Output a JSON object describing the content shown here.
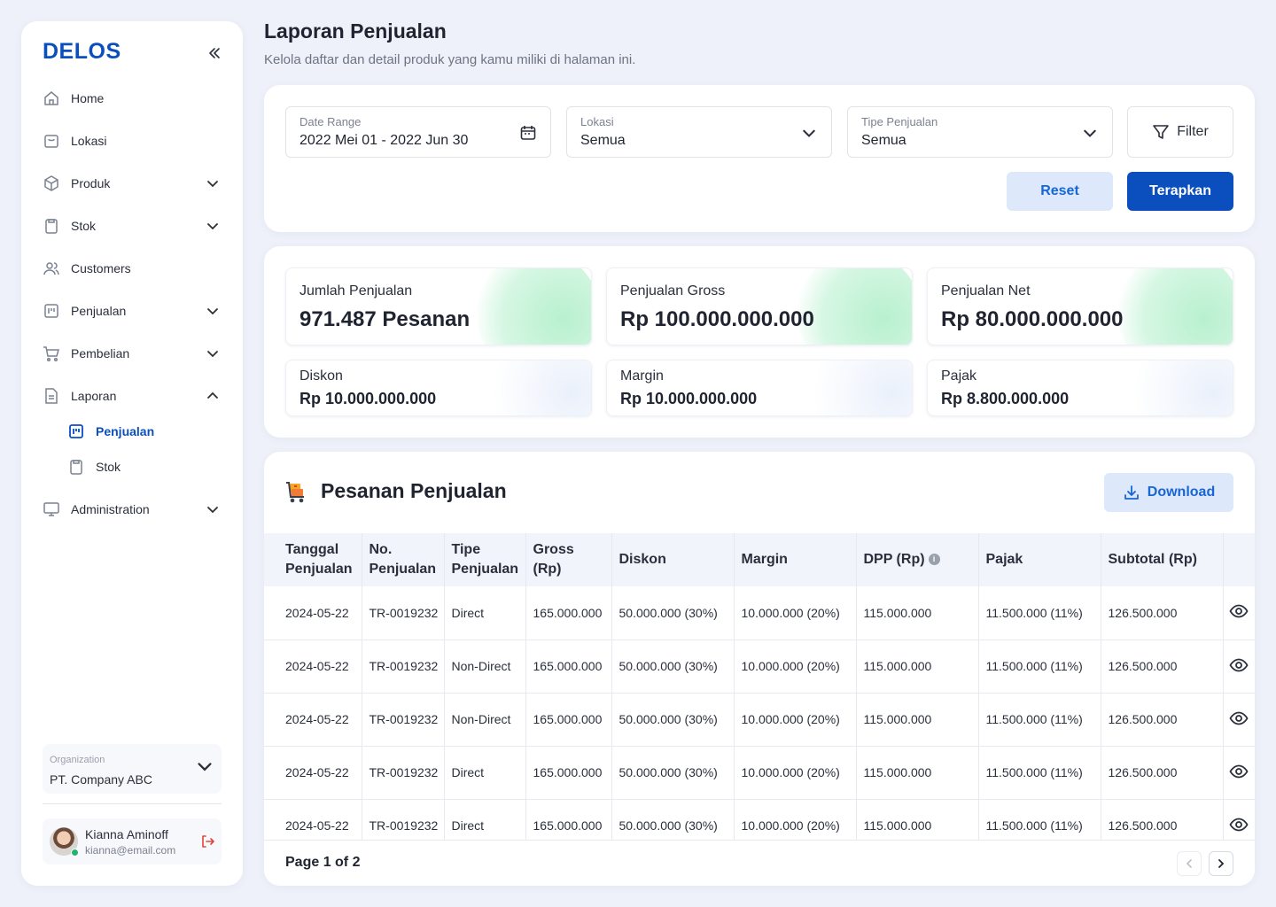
{
  "brand": "DELOS",
  "sidebar": {
    "items": [
      {
        "label": "Home",
        "icon": "home-icon",
        "has_chevron": false
      },
      {
        "label": "Lokasi",
        "icon": "store-icon",
        "has_chevron": false
      },
      {
        "label": "Produk",
        "icon": "box-icon",
        "has_chevron": true
      },
      {
        "label": "Stok",
        "icon": "clipboard-icon",
        "has_chevron": true
      },
      {
        "label": "Customers",
        "icon": "users-icon",
        "has_chevron": false
      },
      {
        "label": "Penjualan",
        "icon": "board-icon",
        "has_chevron": true
      },
      {
        "label": "Pembelian",
        "icon": "cart-icon",
        "has_chevron": true
      },
      {
        "label": "Laporan",
        "icon": "document-icon",
        "has_chevron": true,
        "expanded": true
      },
      {
        "label": "Penjualan",
        "icon": "board-icon",
        "sub": true,
        "active": true
      },
      {
        "label": "Stok",
        "icon": "clipboard-icon",
        "sub": true
      },
      {
        "label": "Administration",
        "icon": "monitor-icon",
        "has_chevron": true
      }
    ],
    "organization": {
      "label": "Organization",
      "value": "PT. Company ABC"
    },
    "user": {
      "name": "Kianna Aminoff",
      "email": "kianna@email.com"
    }
  },
  "header": {
    "title": "Laporan Penjualan",
    "subtitle": "Kelola daftar dan detail produk yang kamu miliki di halaman ini."
  },
  "filters": {
    "date_range": {
      "label": "Date Range",
      "value": "2022 Mei 01 - 2022 Jun 30"
    },
    "lokasi": {
      "label": "Lokasi",
      "value": "Semua"
    },
    "tipe": {
      "label": "Tipe Penjualan",
      "value": "Semua"
    },
    "filter_label": "Filter",
    "reset_label": "Reset",
    "apply_label": "Terapkan"
  },
  "summary": {
    "big": [
      {
        "label": "Jumlah Penjualan",
        "value": "971.487 Pesanan"
      },
      {
        "label": "Penjualan Gross",
        "value": "Rp 100.000.000.000"
      },
      {
        "label": "Penjualan Net",
        "value": "Rp 80.000.000.000"
      }
    ],
    "small": [
      {
        "label": "Diskon",
        "value": "Rp 10.000.000.000"
      },
      {
        "label": "Margin",
        "value": "Rp 10.000.000.000"
      },
      {
        "label": "Pajak",
        "value": "Rp 8.800.000.000"
      }
    ]
  },
  "orders": {
    "title": "Pesanan Penjualan",
    "download_label": "Download",
    "columns": [
      "Tanggal Penjualan",
      "No. Penjualan",
      "Tipe Penjualan",
      "Gross (Rp)",
      "Diskon",
      "Margin",
      "DPP (Rp)",
      "Pajak",
      "Subtotal (Rp)"
    ],
    "rows": [
      [
        "2024-05-22",
        "TR-0019232",
        "Direct",
        "165.000.000",
        "50.000.000 (30%)",
        "10.000.000 (20%)",
        "115.000.000",
        "11.500.000 (11%)",
        "126.500.000"
      ],
      [
        "2024-05-22",
        "TR-0019232",
        "Non-Direct",
        "165.000.000",
        "50.000.000 (30%)",
        "10.000.000 (20%)",
        "115.000.000",
        "11.500.000 (11%)",
        "126.500.000"
      ],
      [
        "2024-05-22",
        "TR-0019232",
        "Non-Direct",
        "165.000.000",
        "50.000.000 (30%)",
        "10.000.000 (20%)",
        "115.000.000",
        "11.500.000 (11%)",
        "126.500.000"
      ],
      [
        "2024-05-22",
        "TR-0019232",
        "Direct",
        "165.000.000",
        "50.000.000 (30%)",
        "10.000.000 (20%)",
        "115.000.000",
        "11.500.000 (11%)",
        "126.500.000"
      ],
      [
        "2024-05-22",
        "TR-0019232",
        "Direct",
        "165.000.000",
        "50.000.000 (30%)",
        "10.000.000 (20%)",
        "115.000.000",
        "11.500.000 (11%)",
        "126.500.000"
      ]
    ],
    "page_info": "Page 1 of 2"
  },
  "colors": {
    "primary": "#0b4fbf",
    "accent_light": "#dde8fb",
    "background": "#eef1f9",
    "success": "#22b46b"
  }
}
